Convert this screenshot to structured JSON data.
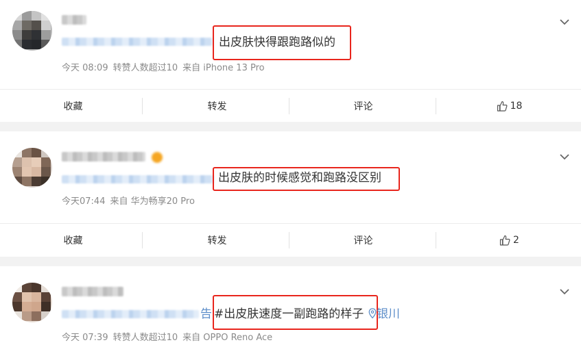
{
  "posts": [
    {
      "content": "出皮肤快得跟跑路似的",
      "meta": {
        "time": "今天 08:09",
        "reposts": "转赞人数超过10",
        "source": "来自 iPhone 13 Pro"
      },
      "actions": {
        "favorite": "收藏",
        "repost": "转发",
        "comment": "评论",
        "like_count": "18"
      }
    },
    {
      "content": "出皮肤的时候感觉和跑路没区别",
      "meta": {
        "time": "今天07:44",
        "source": "来自 华为畅享20 Pro"
      },
      "actions": {
        "favorite": "收藏",
        "repost": "转发",
        "comment": "评论",
        "like_count": "2"
      }
    },
    {
      "tag_visible_tail": "告",
      "content": "#出皮肤速度一副跑路的样子",
      "location": "银川",
      "meta": {
        "time": "今天 07:39",
        "reposts": "转赞人数超过10",
        "source": "来自 OPPO Reno Ace"
      }
    }
  ],
  "colors": {
    "highlight": "#e8251c",
    "link": "#5d8ec9",
    "meta": "#8a8a8a",
    "background": "#f2f2f2"
  }
}
